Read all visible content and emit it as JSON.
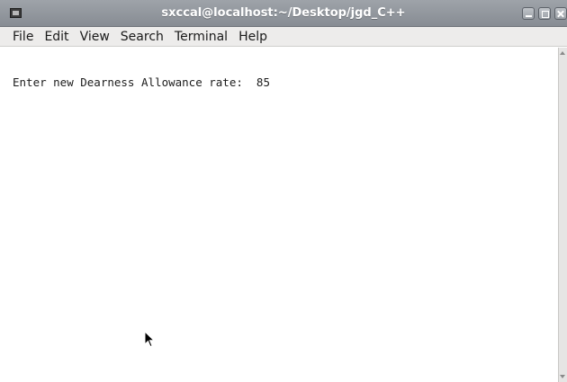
{
  "window": {
    "title": "sxccal@localhost:~/Desktop/jgd_C++"
  },
  "menu": {
    "items": [
      "File",
      "Edit",
      "View",
      "Search",
      "Terminal",
      "Help"
    ]
  },
  "terminal": {
    "lines": [
      "Enter new Dearness Allowance rate:  85"
    ]
  },
  "icons": {
    "app": "terminal-app-icon",
    "minimize": "minimize-icon",
    "maximize": "maximize-icon",
    "close": "close-icon",
    "pointer": "mouse-pointer-icon"
  },
  "colors": {
    "titlebar": "#9198a0",
    "menubar": "#edeceb",
    "terminal_bg": "#ffffff",
    "text": "#1b1b1b"
  }
}
